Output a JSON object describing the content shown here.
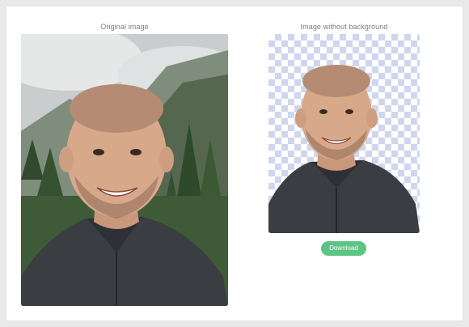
{
  "original": {
    "caption": "Original image"
  },
  "result": {
    "caption": "Image without background"
  },
  "actions": {
    "download_label": "Download"
  },
  "colors": {
    "accent": "#5dc485",
    "caption_text": "#7d7d7d",
    "checker": "#cfd6ee"
  }
}
